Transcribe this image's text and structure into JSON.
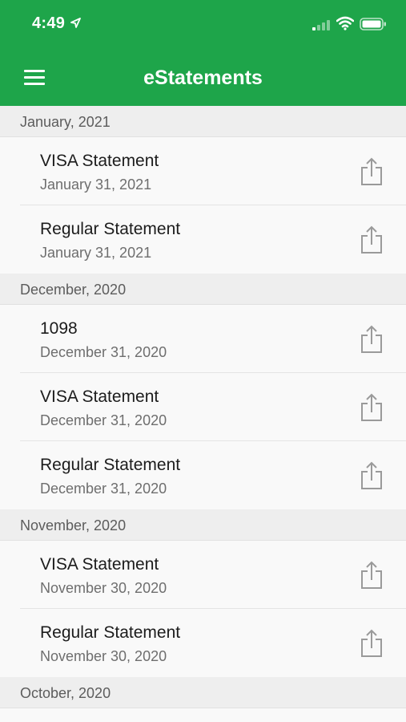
{
  "status_bar": {
    "time": "4:49",
    "location_icon": "location-arrow-icon",
    "signal_icon": "cellular-signal-icon",
    "wifi_icon": "wifi-icon",
    "battery_icon": "battery-icon"
  },
  "header": {
    "title": "eStatements",
    "menu_icon": "hamburger-menu-icon",
    "background_color": "#1ea54a"
  },
  "sections": [
    {
      "label": "January, 2021",
      "items": [
        {
          "name": "VISA Statement",
          "date": "January 31, 2021"
        },
        {
          "name": "Regular Statement",
          "date": "January 31, 2021"
        }
      ]
    },
    {
      "label": "December, 2020",
      "items": [
        {
          "name": "1098",
          "date": "December 31, 2020"
        },
        {
          "name": "VISA Statement",
          "date": "December 31, 2020"
        },
        {
          "name": "Regular Statement",
          "date": "December 31, 2020"
        }
      ]
    },
    {
      "label": "November, 2020",
      "items": [
        {
          "name": "VISA Statement",
          "date": "November 30, 2020"
        },
        {
          "name": "Regular Statement",
          "date": "November 30, 2020"
        }
      ]
    },
    {
      "label": "October, 2020",
      "items": []
    }
  ],
  "share_icon": "share-icon"
}
